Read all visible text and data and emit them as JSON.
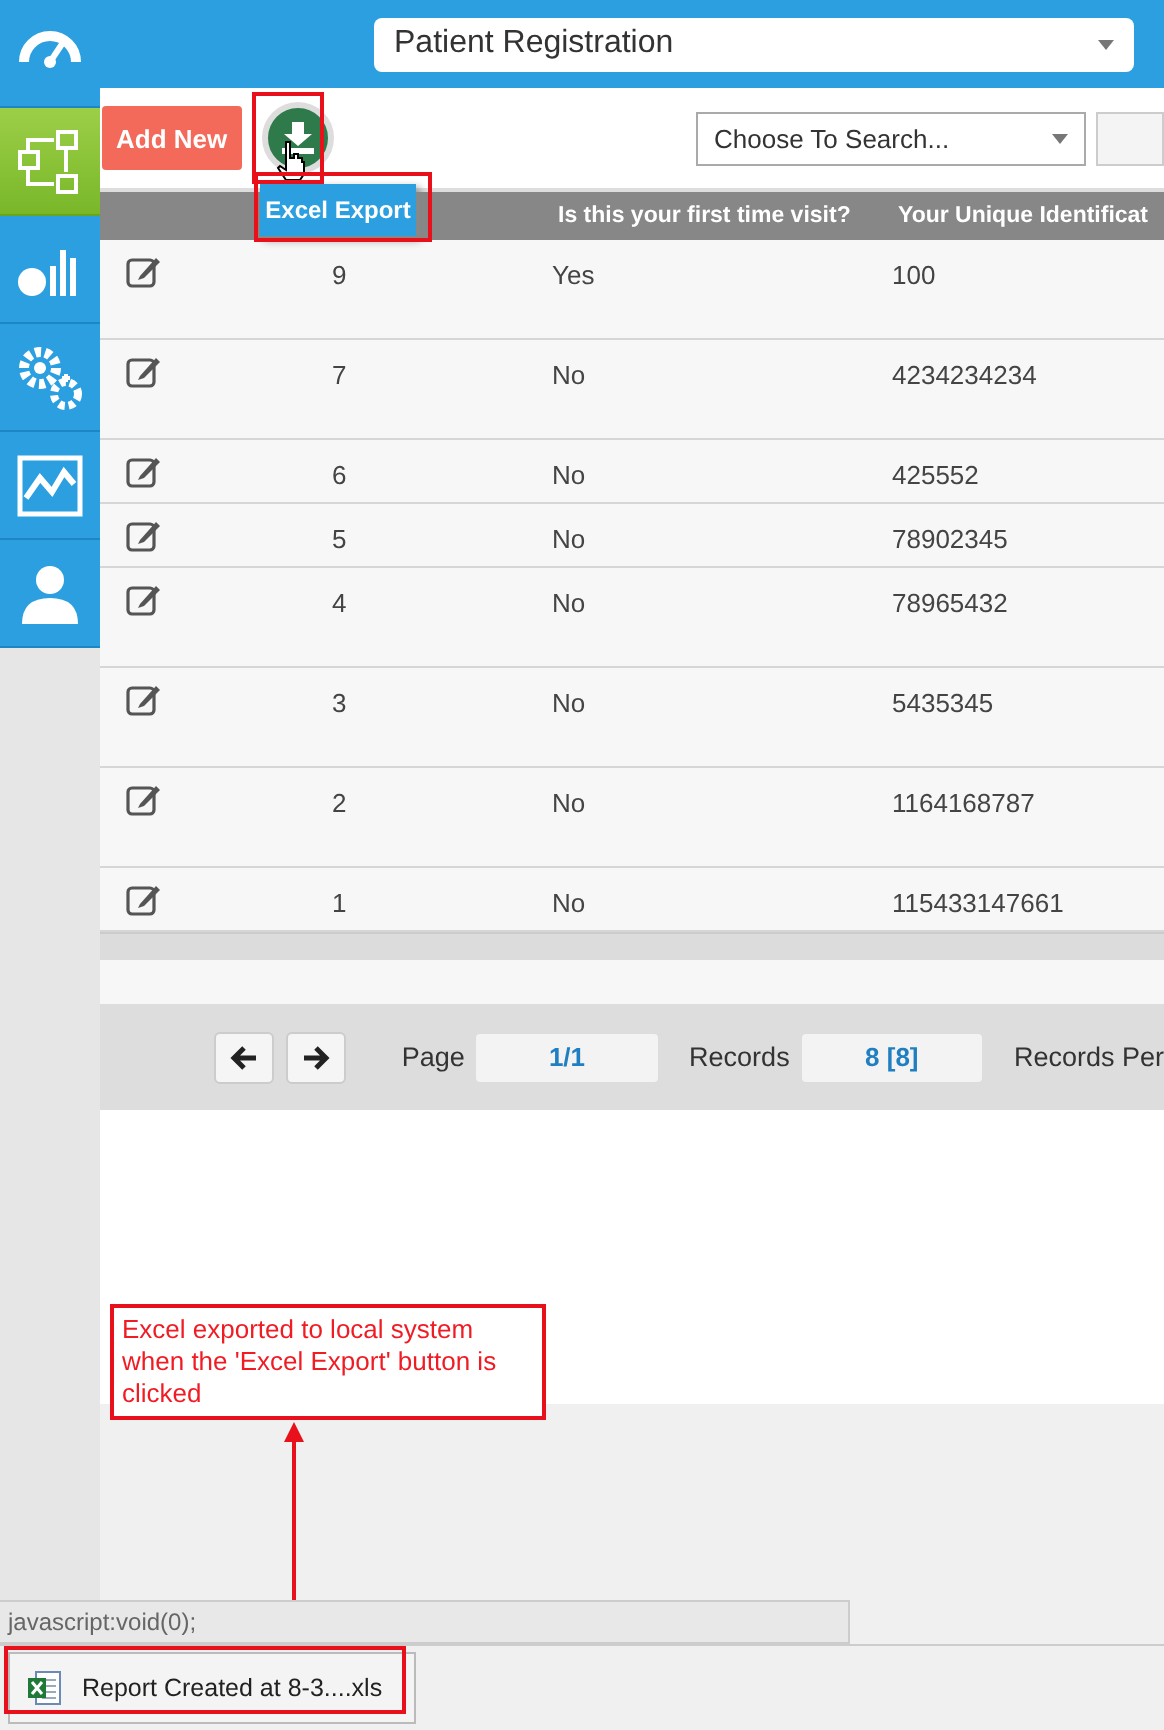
{
  "sidebar": {
    "items": [
      {
        "selected": false
      },
      {
        "selected": true
      },
      {
        "selected": false
      },
      {
        "selected": false
      },
      {
        "selected": false
      },
      {
        "selected": false
      }
    ]
  },
  "form_select": {
    "value": "Patient Registration"
  },
  "toolbar": {
    "add_button": "Add New",
    "export_tooltip": "Excel Export",
    "search_select": {
      "value": "Choose To Search..."
    }
  },
  "table": {
    "column_3": "Is this your first time visit?",
    "column_4": "Your Unique Identificat",
    "rows": [
      {
        "kind": "tall",
        "column_2": "9",
        "column_3": "Yes",
        "column_4": "100"
      },
      {
        "kind": "tall",
        "column_2": "7",
        "column_3": "No",
        "column_4": "4234234234"
      },
      {
        "kind": "short",
        "column_2": "6",
        "column_3": "No",
        "column_4": "425552"
      },
      {
        "kind": "short",
        "column_2": "5",
        "column_3": "No",
        "column_4": "78902345"
      },
      {
        "kind": "tall",
        "column_2": "4",
        "column_3": "No",
        "column_4": "78965432"
      },
      {
        "kind": "tall",
        "column_2": "3",
        "column_3": "No",
        "column_4": "5435345"
      },
      {
        "kind": "tall",
        "column_2": "2",
        "column_3": "No",
        "column_4": "1164168787"
      },
      {
        "kind": "short",
        "column_2": "1",
        "column_3": "No",
        "column_4": "115433147661"
      }
    ]
  },
  "pager": {
    "page_label": "Page",
    "page": "1/1",
    "records_label": "Records",
    "records": "8 [8]",
    "per_page_label": "Records Per"
  },
  "annotation": {
    "text": "Excel exported to local system when the 'Excel Export' button is clicked"
  },
  "status_bar": "javascript:void(0);",
  "download": {
    "file": "Report Created at 8-3....xls"
  }
}
